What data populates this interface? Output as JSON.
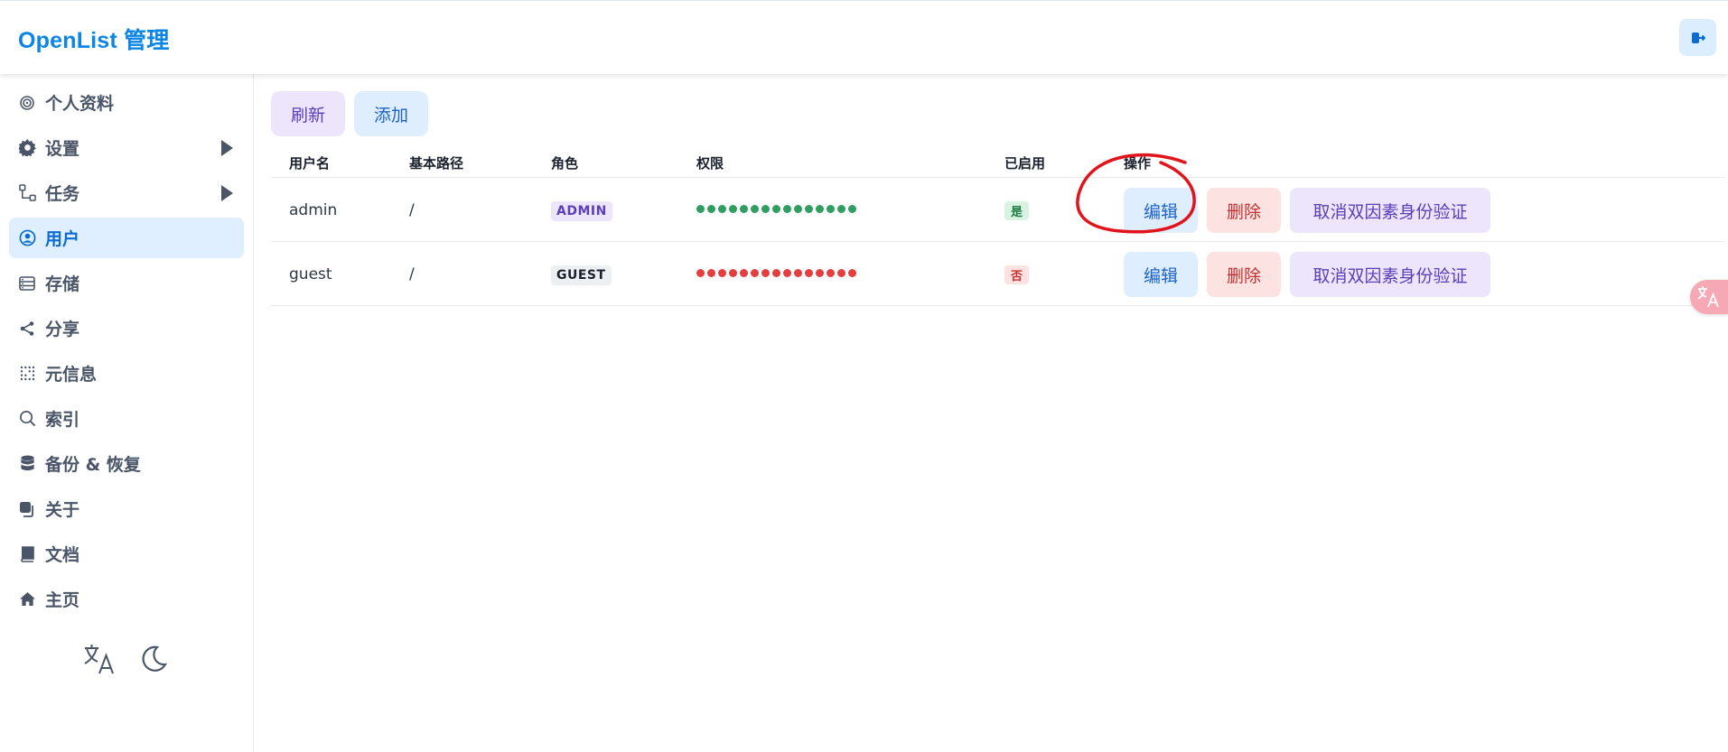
{
  "app": {
    "title": "OpenList 管理"
  },
  "sidebar": {
    "items": [
      {
        "label": "个人资料",
        "icon": "fingerprint-icon"
      },
      {
        "label": "设置",
        "icon": "gear-icon"
      },
      {
        "label": "任务",
        "icon": "workflow-icon"
      },
      {
        "label": "用户",
        "icon": "user-circle-icon",
        "active": true
      },
      {
        "label": "存储",
        "icon": "storage-icon"
      },
      {
        "label": "分享",
        "icon": "share-icon"
      },
      {
        "label": "元信息",
        "icon": "dots-grid-icon"
      },
      {
        "label": "索引",
        "icon": "search-icon"
      },
      {
        "label": "备份 & 恢复",
        "icon": "database-icon"
      },
      {
        "label": "关于",
        "icon": "copy-icon"
      },
      {
        "label": "文档",
        "icon": "book-icon"
      },
      {
        "label": "主页",
        "icon": "home-icon"
      }
    ]
  },
  "toolbar": {
    "refresh_label": "刷新",
    "add_label": "添加"
  },
  "table": {
    "headers": [
      "用户名",
      "基本路径",
      "角色",
      "权限",
      "已启用",
      "操作"
    ],
    "rows": [
      {
        "username": "admin",
        "base_path": "/",
        "role": "ADMIN",
        "permissions_granted": 15,
        "permissions_total": 15,
        "enabled": "是",
        "actions": {
          "edit": "编辑",
          "delete": "删除",
          "disable_2fa": "取消双因素身份验证"
        }
      },
      {
        "username": "guest",
        "base_path": "/",
        "role": "GUEST",
        "permissions_granted": 0,
        "permissions_total": 15,
        "enabled": "否",
        "actions": {
          "edit": "编辑",
          "delete": "删除",
          "disable_2fa": "取消双因素身份验证"
        }
      }
    ]
  },
  "colors": {
    "brand": "#0b85e6",
    "permission_on": "#2f9e60",
    "permission_off": "#e53e3e",
    "annotation": "#e0141a"
  }
}
